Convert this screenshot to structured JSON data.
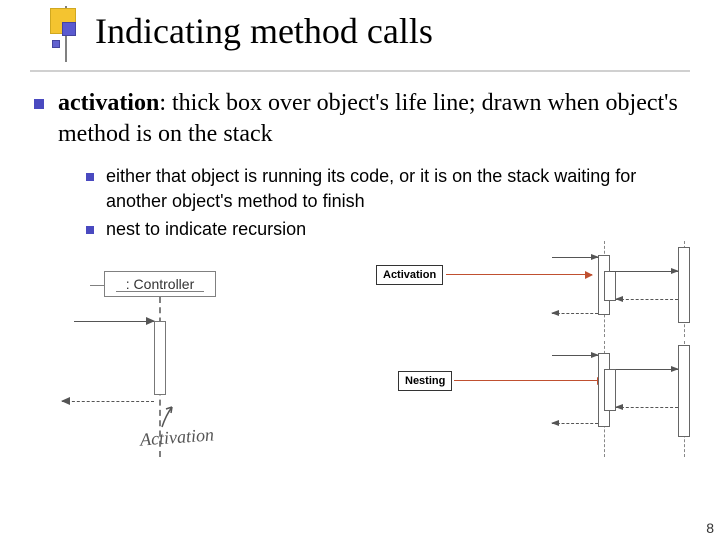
{
  "title": "Indicating method calls",
  "main_bullet": {
    "term": "activation",
    "sep": ": ",
    "desc": "thick box over object's life line; drawn when object's method is on the stack"
  },
  "sub_bullets": [
    "either that object is running its code, or it is on the stack waiting for another object's method to finish",
    "nest to indicate recursion"
  ],
  "diagram": {
    "controller_label": ": Controller",
    "activation_script": "Activation",
    "label_activation": "Activation",
    "label_nesting": "Nesting"
  },
  "page_number": "8"
}
